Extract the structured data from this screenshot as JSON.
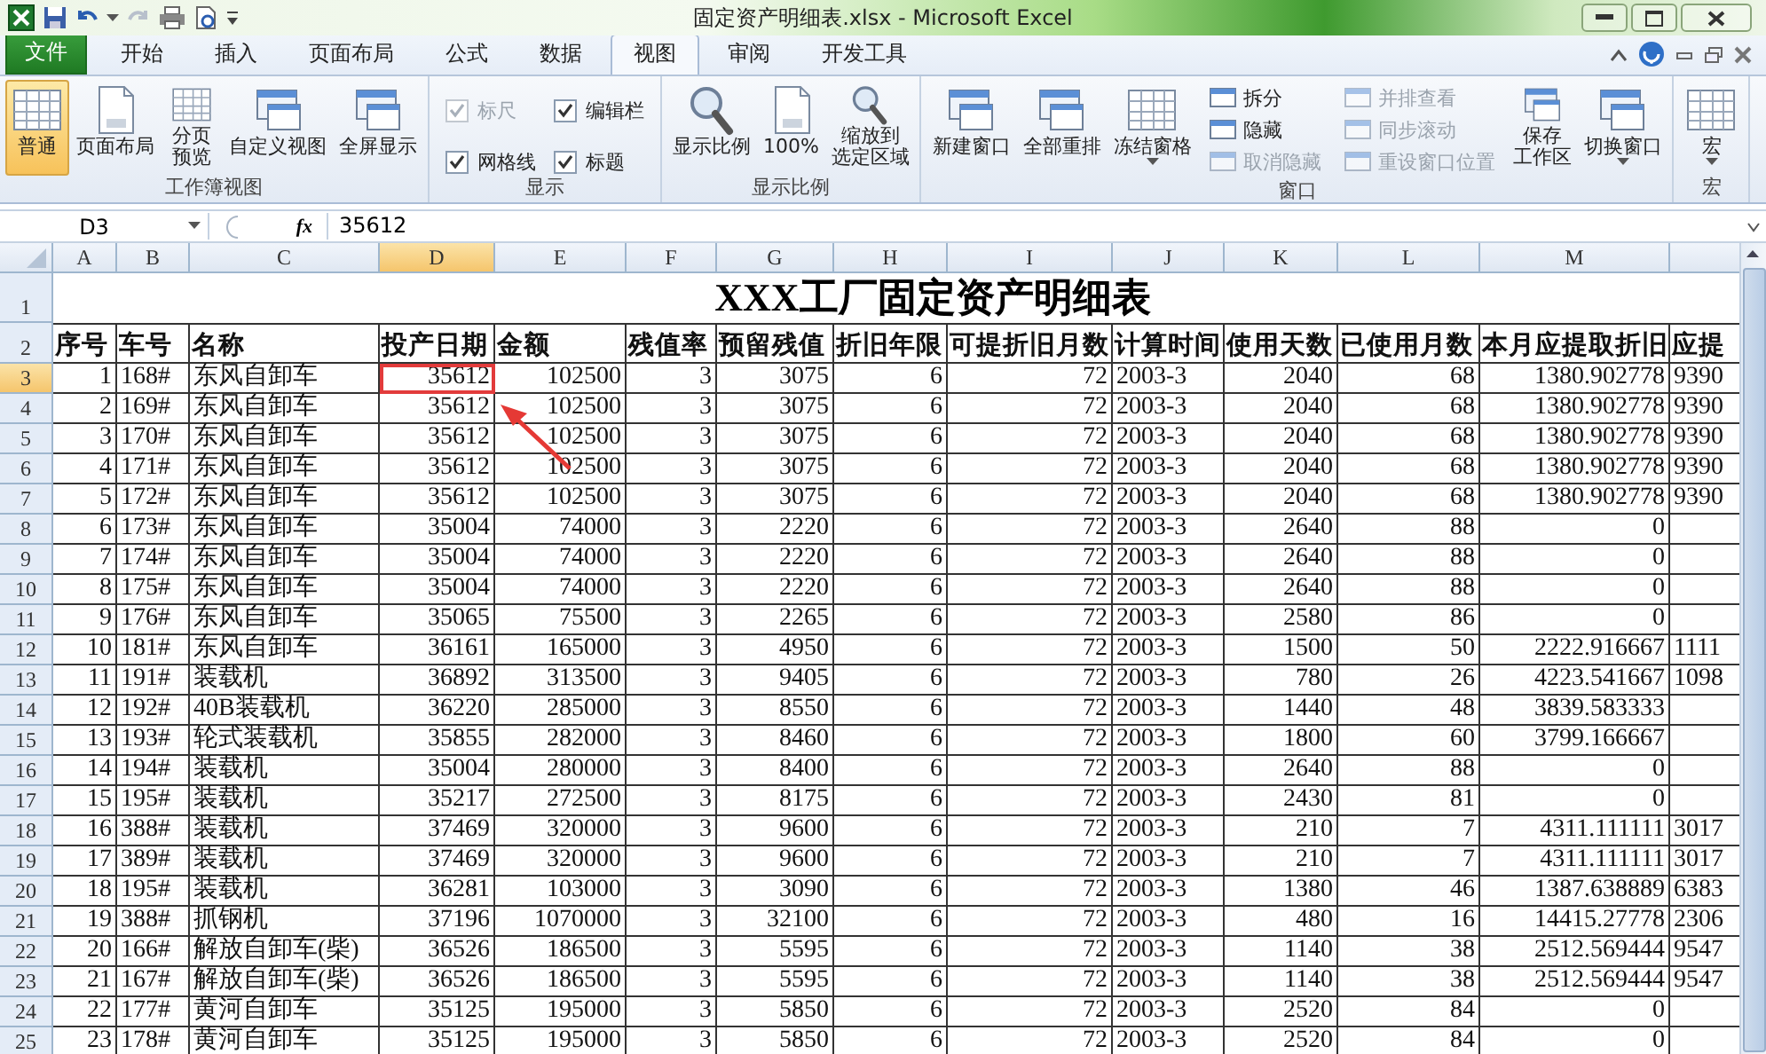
{
  "window": {
    "title": "固定资产明细表.xlsx - Microsoft Excel"
  },
  "tabs": [
    {
      "label": "文件",
      "kind": "file",
      "selected": false
    },
    {
      "label": "开始",
      "kind": "tab",
      "selected": false
    },
    {
      "label": "插入",
      "kind": "tab",
      "selected": false
    },
    {
      "label": "页面布局",
      "kind": "tab",
      "selected": false
    },
    {
      "label": "公式",
      "kind": "tab",
      "selected": false
    },
    {
      "label": "数据",
      "kind": "tab",
      "selected": false
    },
    {
      "label": "视图",
      "kind": "tab",
      "selected": true
    },
    {
      "label": "审阅",
      "kind": "tab",
      "selected": false
    },
    {
      "label": "开发工具",
      "kind": "tab",
      "selected": false
    }
  ],
  "ribbon_groups": [
    {
      "label": "工作簿视图",
      "items": [
        {
          "kind": "large",
          "label": "普通",
          "selected": true,
          "dropdown": false,
          "disabled": false
        },
        {
          "kind": "large",
          "label": "页面布局",
          "selected": false,
          "dropdown": false,
          "disabled": false
        },
        {
          "kind": "large",
          "label": [
            "分页",
            "预览"
          ],
          "selected": false,
          "dropdown": false,
          "disabled": false
        },
        {
          "kind": "large",
          "label": "自定义视图",
          "selected": false,
          "dropdown": false,
          "disabled": false
        },
        {
          "kind": "large",
          "label": "全屏显示",
          "selected": false,
          "dropdown": false,
          "disabled": false
        }
      ]
    },
    {
      "label": "显示",
      "items": [
        {
          "kind": "check",
          "label": "标尺",
          "checked": true,
          "disabled": true
        },
        {
          "kind": "check",
          "label": "编辑栏",
          "checked": true,
          "disabled": false
        },
        {
          "kind": "check",
          "label": "网格线",
          "checked": true,
          "disabled": false
        },
        {
          "kind": "check",
          "label": "标题",
          "checked": true,
          "disabled": false
        }
      ]
    },
    {
      "label": "显示比例",
      "items": [
        {
          "kind": "large",
          "label": "显示比例",
          "dropdown": false,
          "disabled": false
        },
        {
          "kind": "large",
          "label": "100%",
          "dropdown": false,
          "disabled": false
        },
        {
          "kind": "large",
          "label": [
            "缩放到",
            "选定区域"
          ],
          "dropdown": false,
          "disabled": false
        }
      ]
    },
    {
      "label": "窗口",
      "items": [
        {
          "kind": "large",
          "label": "新建窗口",
          "dropdown": false,
          "disabled": false
        },
        {
          "kind": "large",
          "label": "全部重排",
          "dropdown": false,
          "disabled": false
        },
        {
          "kind": "large",
          "label": "冻结窗格",
          "dropdown": true,
          "disabled": false
        },
        {
          "kind": "small",
          "label": "拆分",
          "disabled": false
        },
        {
          "kind": "small",
          "label": "隐藏",
          "disabled": false
        },
        {
          "kind": "small",
          "label": "取消隐藏",
          "disabled": true
        },
        {
          "kind": "small",
          "label": "并排查看",
          "disabled": true
        },
        {
          "kind": "small",
          "label": "同步滚动",
          "disabled": true
        },
        {
          "kind": "small",
          "label": "重设窗口位置",
          "disabled": true
        },
        {
          "kind": "large",
          "label": [
            "保存",
            "工作区"
          ],
          "dropdown": false,
          "disabled": false
        },
        {
          "kind": "large",
          "label": "切换窗口",
          "dropdown": true,
          "disabled": false
        }
      ]
    },
    {
      "label": "宏",
      "items": [
        {
          "kind": "large",
          "label": "宏",
          "dropdown": true,
          "disabled": false
        }
      ]
    }
  ],
  "formula_bar": {
    "name_box": "D3",
    "function_button": "fx",
    "formula": "35612"
  },
  "sheet": {
    "columns": [
      {
        "label": "A",
        "selected": false
      },
      {
        "label": "B",
        "selected": false
      },
      {
        "label": "C",
        "selected": false
      },
      {
        "label": "D",
        "selected": true
      },
      {
        "label": "E",
        "selected": false
      },
      {
        "label": "F",
        "selected": false
      },
      {
        "label": "G",
        "selected": false
      },
      {
        "label": "H",
        "selected": false
      },
      {
        "label": "I",
        "selected": false
      },
      {
        "label": "J",
        "selected": false
      },
      {
        "label": "K",
        "selected": false
      },
      {
        "label": "L",
        "selected": false
      },
      {
        "label": "M",
        "selected": false
      }
    ],
    "title_row": {
      "number": "1",
      "text": "XXX工厂固定资产明细表"
    },
    "header_row": {
      "number": "2",
      "cells": [
        "序号",
        "车号",
        "名称",
        "投产日期",
        "金额",
        "残值率",
        "预留残值",
        "折旧年限",
        "可提折旧月数",
        "计算时间",
        "使用天数",
        "已使用月数",
        "本月应提取折旧",
        "应提"
      ]
    },
    "rows": [
      {
        "number": "3",
        "selected": true,
        "cells": [
          "1",
          "168#",
          "东风自卸车",
          "35612",
          "102500",
          "3",
          "3075",
          "6",
          "72",
          "2003-3",
          "2040",
          "68",
          "1380.902778",
          "9390"
        ]
      },
      {
        "number": "4",
        "selected": false,
        "cells": [
          "2",
          "169#",
          "东风自卸车",
          "35612",
          "102500",
          "3",
          "3075",
          "6",
          "72",
          "2003-3",
          "2040",
          "68",
          "1380.902778",
          "9390"
        ]
      },
      {
        "number": "5",
        "selected": false,
        "cells": [
          "3",
          "170#",
          "东风自卸车",
          "35612",
          "102500",
          "3",
          "3075",
          "6",
          "72",
          "2003-3",
          "2040",
          "68",
          "1380.902778",
          "9390"
        ]
      },
      {
        "number": "6",
        "selected": false,
        "cells": [
          "4",
          "171#",
          "东风自卸车",
          "35612",
          "102500",
          "3",
          "3075",
          "6",
          "72",
          "2003-3",
          "2040",
          "68",
          "1380.902778",
          "9390"
        ]
      },
      {
        "number": "7",
        "selected": false,
        "cells": [
          "5",
          "172#",
          "东风自卸车",
          "35612",
          "102500",
          "3",
          "3075",
          "6",
          "72",
          "2003-3",
          "2040",
          "68",
          "1380.902778",
          "9390"
        ]
      },
      {
        "number": "8",
        "selected": false,
        "cells": [
          "6",
          "173#",
          "东风自卸车",
          "35004",
          "74000",
          "3",
          "2220",
          "6",
          "72",
          "2003-3",
          "2640",
          "88",
          "0"
        ]
      },
      {
        "number": "9",
        "selected": false,
        "cells": [
          "7",
          "174#",
          "东风自卸车",
          "35004",
          "74000",
          "3",
          "2220",
          "6",
          "72",
          "2003-3",
          "2640",
          "88",
          "0"
        ]
      },
      {
        "number": "10",
        "selected": false,
        "cells": [
          "8",
          "175#",
          "东风自卸车",
          "35004",
          "74000",
          "3",
          "2220",
          "6",
          "72",
          "2003-3",
          "2640",
          "88",
          "0"
        ]
      },
      {
        "number": "11",
        "selected": false,
        "cells": [
          "9",
          "176#",
          "东风自卸车",
          "35065",
          "75500",
          "3",
          "2265",
          "6",
          "72",
          "2003-3",
          "2580",
          "86",
          "0"
        ]
      },
      {
        "number": "12",
        "selected": false,
        "cells": [
          "10",
          "181#",
          "东风自卸车",
          "36161",
          "165000",
          "3",
          "4950",
          "6",
          "72",
          "2003-3",
          "1500",
          "50",
          "2222.916667",
          "1111"
        ]
      },
      {
        "number": "13",
        "selected": false,
        "cells": [
          "11",
          "191#",
          "装载机",
          "36892",
          "313500",
          "3",
          "9405",
          "6",
          "72",
          "2003-3",
          "780",
          "26",
          "4223.541667",
          "1098"
        ]
      },
      {
        "number": "14",
        "selected": false,
        "cells": [
          "12",
          "192#",
          "40B装载机",
          "36220",
          "285000",
          "3",
          "8550",
          "6",
          "72",
          "2003-3",
          "1440",
          "48",
          "3839.583333"
        ]
      },
      {
        "number": "15",
        "selected": false,
        "cells": [
          "13",
          "193#",
          "轮式装载机",
          "35855",
          "282000",
          "3",
          "8460",
          "6",
          "72",
          "2003-3",
          "1800",
          "60",
          "3799.166667"
        ]
      },
      {
        "number": "16",
        "selected": false,
        "cells": [
          "14",
          "194#",
          "装载机",
          "35004",
          "280000",
          "3",
          "8400",
          "6",
          "72",
          "2003-3",
          "2640",
          "88",
          "0"
        ]
      },
      {
        "number": "17",
        "selected": false,
        "cells": [
          "15",
          "195#",
          "装载机",
          "35217",
          "272500",
          "3",
          "8175",
          "6",
          "72",
          "2003-3",
          "2430",
          "81",
          "0"
        ]
      },
      {
        "number": "18",
        "selected": false,
        "cells": [
          "16",
          "388#",
          "装载机",
          "37469",
          "320000",
          "3",
          "9600",
          "6",
          "72",
          "2003-3",
          "210",
          "7",
          "4311.111111",
          "3017"
        ]
      },
      {
        "number": "19",
        "selected": false,
        "cells": [
          "17",
          "389#",
          "装载机",
          "37469",
          "320000",
          "3",
          "9600",
          "6",
          "72",
          "2003-3",
          "210",
          "7",
          "4311.111111",
          "3017"
        ]
      },
      {
        "number": "20",
        "selected": false,
        "cells": [
          "18",
          "195#",
          "装载机",
          "36281",
          "103000",
          "3",
          "3090",
          "6",
          "72",
          "2003-3",
          "1380",
          "46",
          "1387.638889",
          "6383"
        ]
      },
      {
        "number": "21",
        "selected": false,
        "cells": [
          "19",
          "388#",
          "抓钢机",
          "37196",
          "1070000",
          "3",
          "32100",
          "6",
          "72",
          "2003-3",
          "480",
          "16",
          "14415.27778",
          "2306"
        ]
      },
      {
        "number": "22",
        "selected": false,
        "cells": [
          "20",
          "166#",
          "解放自卸车(柴)",
          "36526",
          "186500",
          "3",
          "5595",
          "6",
          "72",
          "2003-3",
          "1140",
          "38",
          "2512.569444",
          "9547"
        ]
      },
      {
        "number": "23",
        "selected": false,
        "cells": [
          "21",
          "167#",
          "解放自卸车(柴)",
          "36526",
          "186500",
          "3",
          "5595",
          "6",
          "72",
          "2003-3",
          "1140",
          "38",
          "2512.569444",
          "9547"
        ]
      },
      {
        "number": "24",
        "selected": false,
        "cells": [
          "22",
          "177#",
          "黄河自卸车",
          "35125",
          "195000",
          "3",
          "5850",
          "6",
          "72",
          "2003-3",
          "2520",
          "84",
          "0"
        ]
      },
      {
        "number": "25",
        "selected": false,
        "cells": [
          "23",
          "178#",
          "黄河自卸车",
          "35125",
          "195000",
          "3",
          "5850",
          "6",
          "72",
          "2003-3",
          "2520",
          "84",
          "0"
        ]
      }
    ]
  }
}
